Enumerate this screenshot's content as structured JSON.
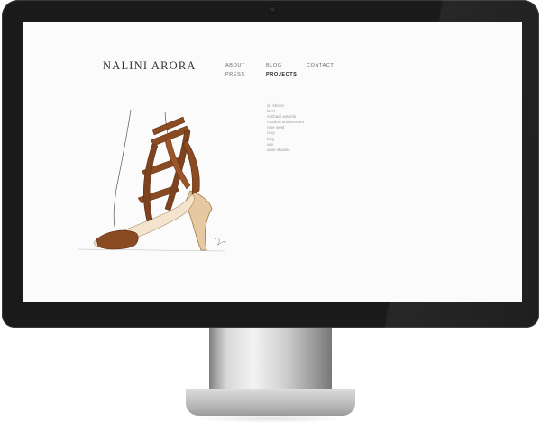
{
  "site": {
    "brand": "NALINI ARORA"
  },
  "nav": [
    {
      "label": "ABOUT",
      "active": false
    },
    {
      "label": "BLOG",
      "active": false
    },
    {
      "label": "CONTACT",
      "active": false
    },
    {
      "label": "PRESS",
      "active": false
    },
    {
      "label": "PROJECTS",
      "active": true
    }
  ],
  "projects": [
    "dr. shoes",
    "kezz",
    "michael antonio",
    "modern amusement",
    "nine west",
    "roxy",
    "ferg",
    "umi",
    "vase studios"
  ],
  "colors": {
    "accent": "#8a4a22",
    "heel": "#e6c9a0",
    "screen_bg": "#fbfbfb",
    "bezel": "#1a1a1a"
  },
  "icons": [
    "camera-icon"
  ]
}
